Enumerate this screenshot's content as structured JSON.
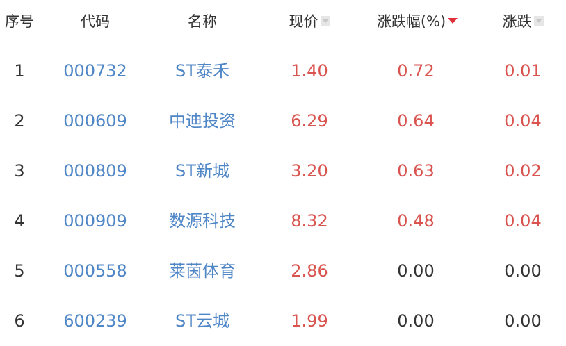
{
  "headers": {
    "index": "序号",
    "code": "代码",
    "name": "名称",
    "price": "现价",
    "pct": "涨跌幅(%)",
    "change": "涨跌"
  },
  "icons": {
    "price_sort": "sort-inactive-icon",
    "pct_sort": "sort-desc-active-icon",
    "change_sort": "sort-inactive-icon"
  },
  "colors": {
    "up": "#d9534f",
    "link": "#4f86c6",
    "neutral": "#333333",
    "sort_active": "#e0303a"
  },
  "rows": [
    {
      "index": "1",
      "code": "000732",
      "name": "ST泰禾",
      "price": "1.40",
      "pct": "0.72",
      "change": "0.01",
      "trend": "up"
    },
    {
      "index": "2",
      "code": "000609",
      "name": "中迪投资",
      "price": "6.29",
      "pct": "0.64",
      "change": "0.04",
      "trend": "up"
    },
    {
      "index": "3",
      "code": "000809",
      "name": "ST新城",
      "price": "3.20",
      "pct": "0.63",
      "change": "0.02",
      "trend": "up"
    },
    {
      "index": "4",
      "code": "000909",
      "name": "数源科技",
      "price": "8.32",
      "pct": "0.48",
      "change": "0.04",
      "trend": "up"
    },
    {
      "index": "5",
      "code": "000558",
      "name": "莱茵体育",
      "price": "2.86",
      "pct": "0.00",
      "change": "0.00",
      "trend": "flat"
    },
    {
      "index": "6",
      "code": "600239",
      "name": "ST云城",
      "price": "1.99",
      "pct": "0.00",
      "change": "0.00",
      "trend": "flat"
    }
  ]
}
